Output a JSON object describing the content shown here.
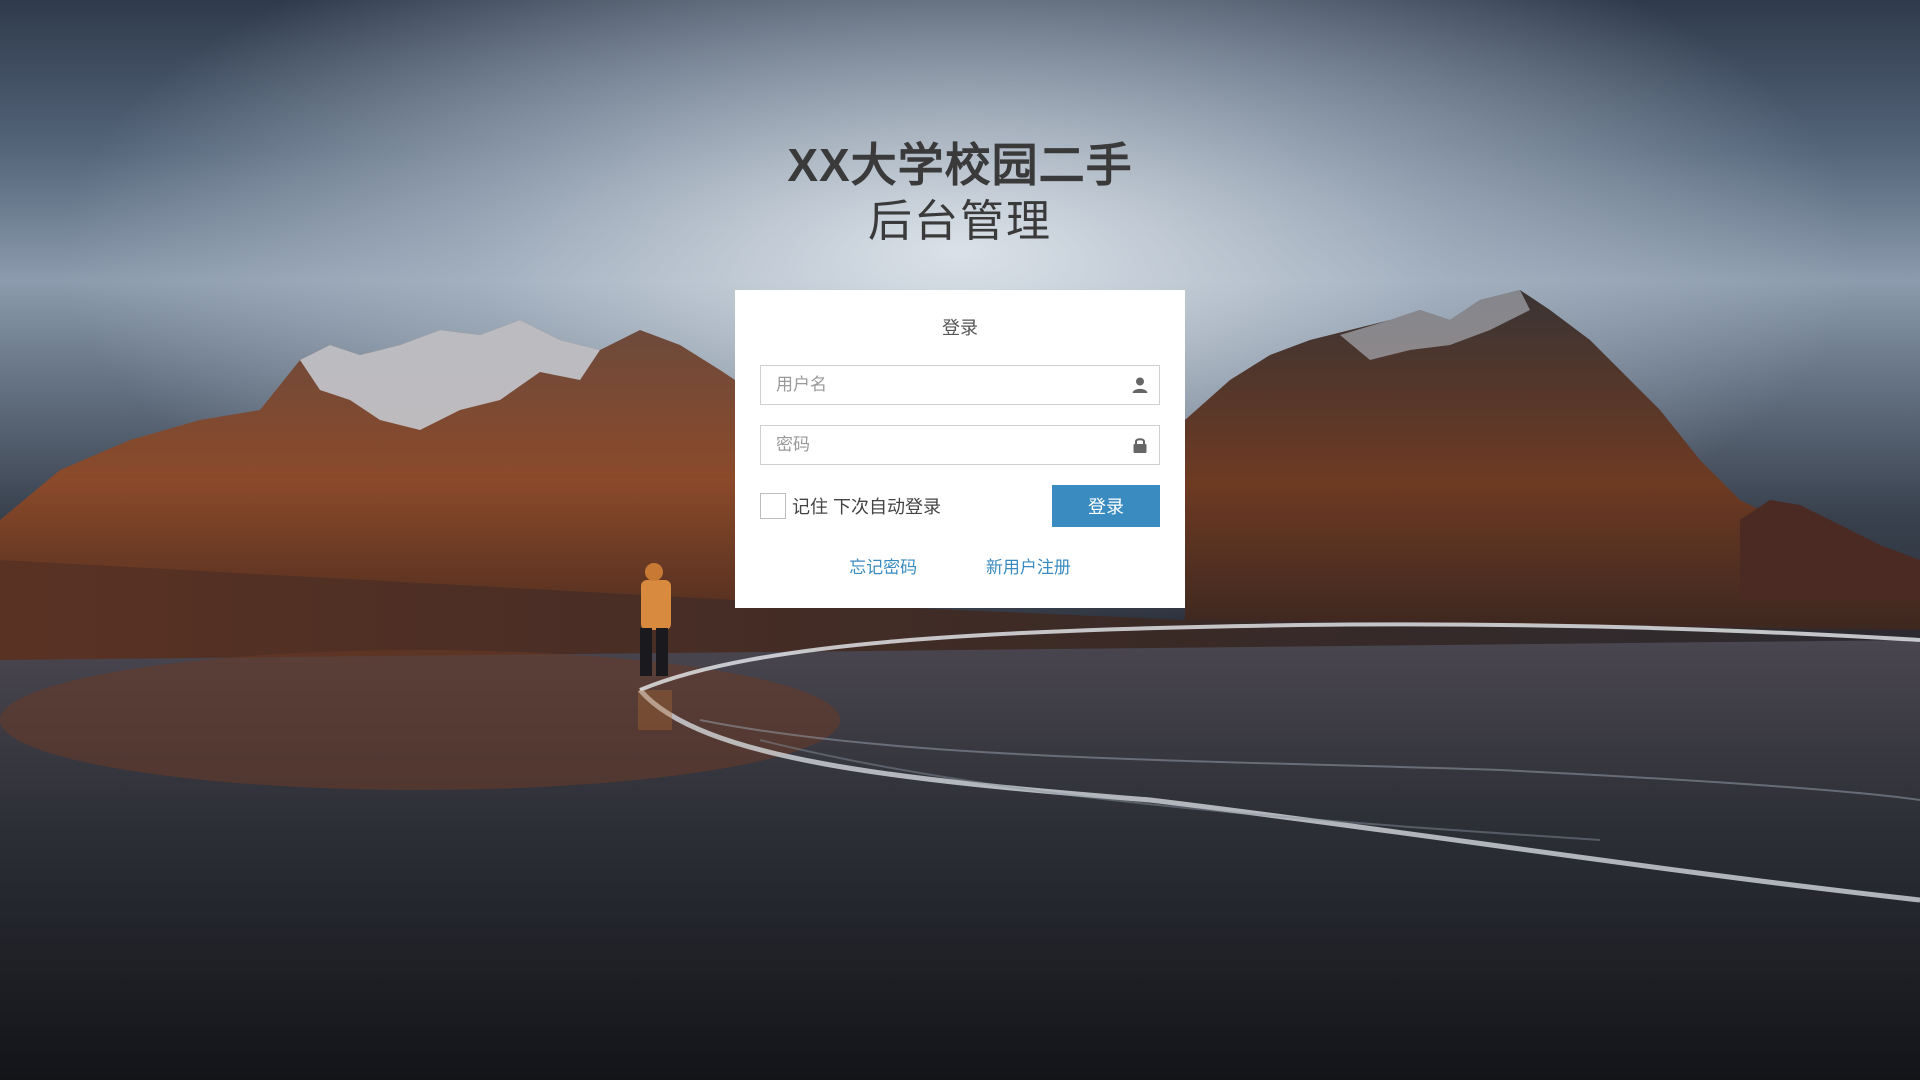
{
  "header": {
    "title": "XX大学校园二手",
    "subtitle": "后台管理"
  },
  "login": {
    "card_title": "登录",
    "username": {
      "placeholder": "用户名",
      "value": "",
      "icon": "user-icon"
    },
    "password": {
      "placeholder": "密码",
      "value": "",
      "icon": "lock-icon"
    },
    "remember_label": "记住 下次自动登录",
    "remember_checked": false,
    "submit_label": "登录",
    "forgot_link": "忘记密码",
    "register_link": "新用户注册"
  },
  "colors": {
    "accent": "#3a8bbf",
    "card_bg": "#ffffff",
    "title_text": "#3a3a3a"
  }
}
